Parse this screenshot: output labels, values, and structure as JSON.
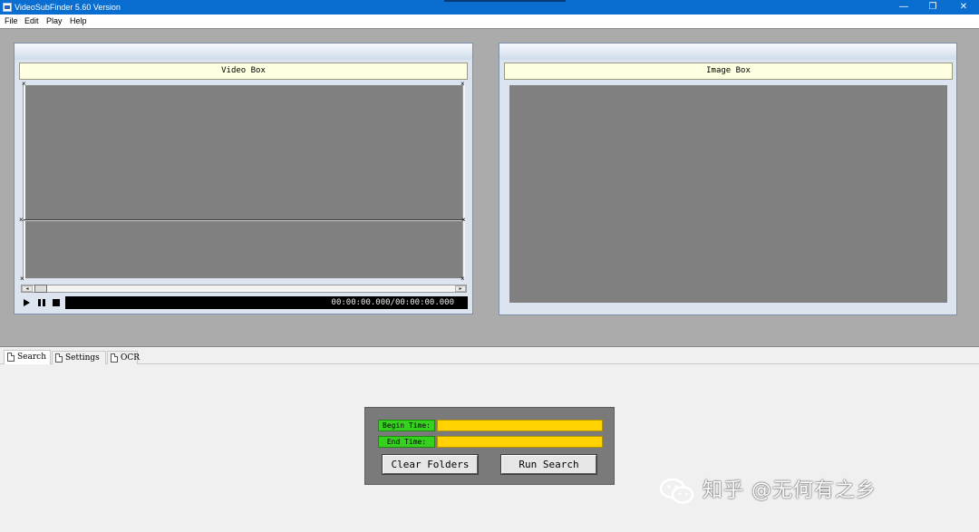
{
  "window": {
    "title": "VideoSubFinder 5.60 Version",
    "minimize_glyph": "—",
    "maximize_glyph": "❐",
    "close_glyph": "✕"
  },
  "menu": {
    "items": [
      "File",
      "Edit",
      "Play",
      "Help"
    ]
  },
  "video_box": {
    "title": "Video Box",
    "time_display": "00:00:00.000/00:00:00.000",
    "scroll_left_glyph": "◂",
    "scroll_right_glyph": "▸"
  },
  "image_box": {
    "title": "Image Box"
  },
  "tabs": [
    {
      "label": "Search",
      "active": true
    },
    {
      "label": "Settings",
      "active": false
    },
    {
      "label": "OCR",
      "active": false
    }
  ],
  "search_panel": {
    "begin_time_label": "Begin Time:",
    "begin_time_value": "",
    "end_time_label": "End Time:",
    "end_time_value": "",
    "clear_folders_label": "Clear Folders",
    "run_search_label": "Run Search"
  },
  "watermark": {
    "text": "知乎 @无何有之乡"
  },
  "colors": {
    "titlebar": "#0a6ed1",
    "workspace": "#ababab",
    "screen": "#808080",
    "box_header": "#ffffe1",
    "time_label_bg": "#36d11e",
    "time_field_bg": "#ffd200"
  },
  "icons": {
    "app": "app-icon",
    "play": "play-icon",
    "pause": "pause-icon",
    "stop": "stop-icon",
    "tab_page": "document-icon",
    "watermark": "wechat-icon"
  }
}
